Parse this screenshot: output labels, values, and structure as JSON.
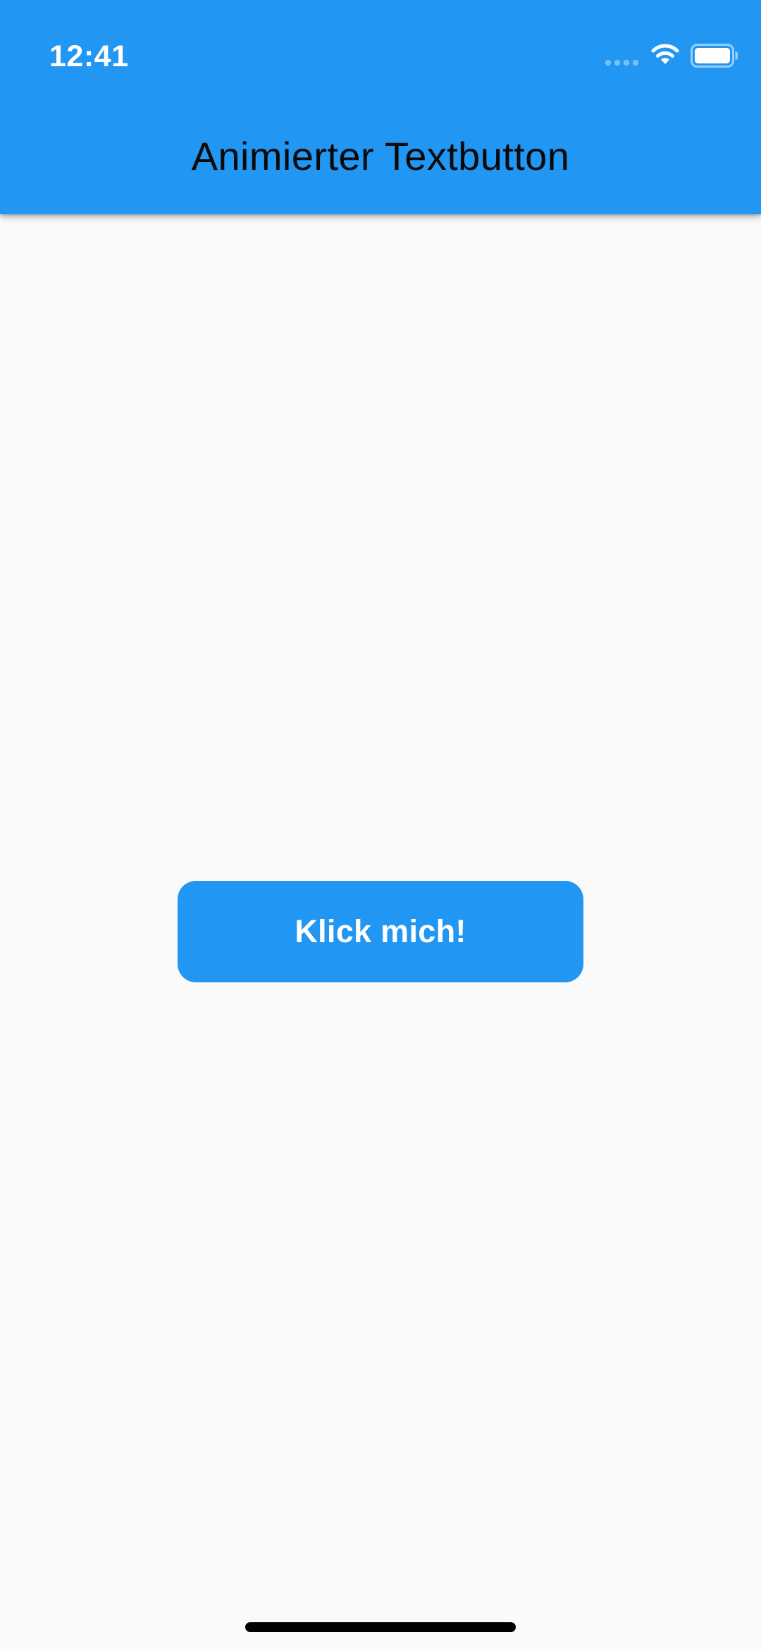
{
  "status_bar": {
    "time": "12:41",
    "icons": [
      "signal-icon",
      "wifi-icon",
      "battery-icon"
    ]
  },
  "app_bar": {
    "title": "Animierter Textbutton"
  },
  "main": {
    "button_label": "Klick mich!"
  },
  "colors": {
    "primary": "#2196f3",
    "background": "#fafafa",
    "title_text": "#0a0a0a",
    "button_text": "#ffffff"
  }
}
